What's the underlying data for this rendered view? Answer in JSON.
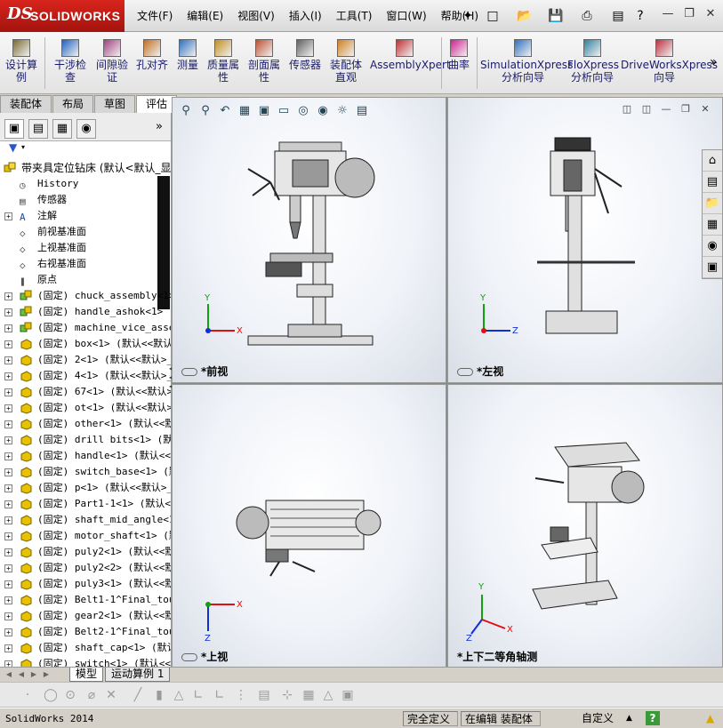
{
  "app": {
    "logo_ds": "DS",
    "logo_name": "SOLIDWORKS",
    "menus": [
      "文件(F)",
      "编辑(E)",
      "视图(V)",
      "插入(I)",
      "工具(T)",
      "窗口(W)",
      "帮助(H)"
    ]
  },
  "commands": [
    {
      "label": "设计算例",
      "name": "design-study-button"
    },
    {
      "label": "干涉检查",
      "name": "interference-check-button"
    },
    {
      "label": "间隙验证",
      "name": "clearance-verify-button"
    },
    {
      "label": "孔对齐",
      "name": "hole-align-button"
    },
    {
      "label": "测量",
      "name": "measure-button"
    },
    {
      "label": "质量属性",
      "name": "mass-props-button"
    },
    {
      "label": "剖面属性",
      "name": "section-props-button"
    },
    {
      "label": "传感器",
      "name": "sensor-button"
    },
    {
      "label": "装配体直观",
      "name": "assembly-visual-button"
    },
    {
      "label": "AssemblyXpert",
      "name": "assemblyxpert-button"
    },
    {
      "label": "曲率",
      "name": "curvature-button"
    },
    {
      "label": "SimulationXpress 分析向导",
      "name": "simulationxpress-button"
    },
    {
      "label": "FloXpress 分析向导",
      "name": "floxpress-button"
    },
    {
      "label": "DriveWorksXpress 向导",
      "name": "driveworksxpress-button"
    }
  ],
  "more_label": "»",
  "cmd_tabs": [
    "装配体",
    "布局",
    "草图",
    "评估"
  ],
  "active_cmd_tab": "评估",
  "tree": {
    "root": "带夹具定位钻床  (默认<默认_显",
    "fixed_items": [
      {
        "label": "History"
      },
      {
        "label": "传感器"
      },
      {
        "label": "注解"
      },
      {
        "label": "前视基准面"
      },
      {
        "label": "上视基准面"
      },
      {
        "label": "右视基准面"
      },
      {
        "label": "原点"
      }
    ],
    "components": [
      "(固定) chuck_assembly<1> (默",
      "(固定) handle_ashok<1> (默",
      "(固定) machine_vice_assem",
      "(固定) box<1> (默认<<默认>",
      "(固定) 2<1> (默认<<默认>_",
      "(固定) 4<1> (默认<<默认>_",
      "(固定) 67<1> (默认<<默认>",
      "(固定) ot<1> (默认<<默认>",
      "(固定) other<1> (默认<<默认",
      "(固定) drill bits<1> (默认",
      "(固定) handle<1> (默认<<默",
      "(固定) switch_base<1> (默",
      "(固定) p<1> (默认<<默认>_",
      "(固定) Part1-1<1> (默认<<",
      "(固定) shaft_mid_angle<1>",
      "(固定) motor_shaft<1> (默",
      "(固定) puly2<1> (默认<<默",
      "(固定) puly2<2> (默认<<默",
      "(固定) puly3<1> (默认<<默",
      "(固定) Belt1-1^Final_touc",
      "(固定) gear2<1> (默认<<默",
      "(固定) Belt2-1^Final_touc",
      "(固定) shaft_cap<1> (默认",
      "(固定) switch<1> (默认<<"
    ]
  },
  "viewports": {
    "front": "*前视",
    "left": "*左视",
    "top": "*上视",
    "iso": "*上下二等角轴测"
  },
  "axes": {
    "x": "X",
    "y": "Y",
    "z": "Z"
  },
  "bottom_tabs": [
    "模型",
    "运动算例 1"
  ],
  "status": {
    "app": "SolidWorks 2014",
    "defined": "完全定义",
    "editing": "在编辑 装配体",
    "units": "自定义"
  },
  "colors": {
    "brand_red": "#c81c16",
    "tree_fixed_icon": "#e8c200",
    "axis_x": "#e01010",
    "axis_y": "#10a010",
    "axis_z": "#1030d0"
  }
}
